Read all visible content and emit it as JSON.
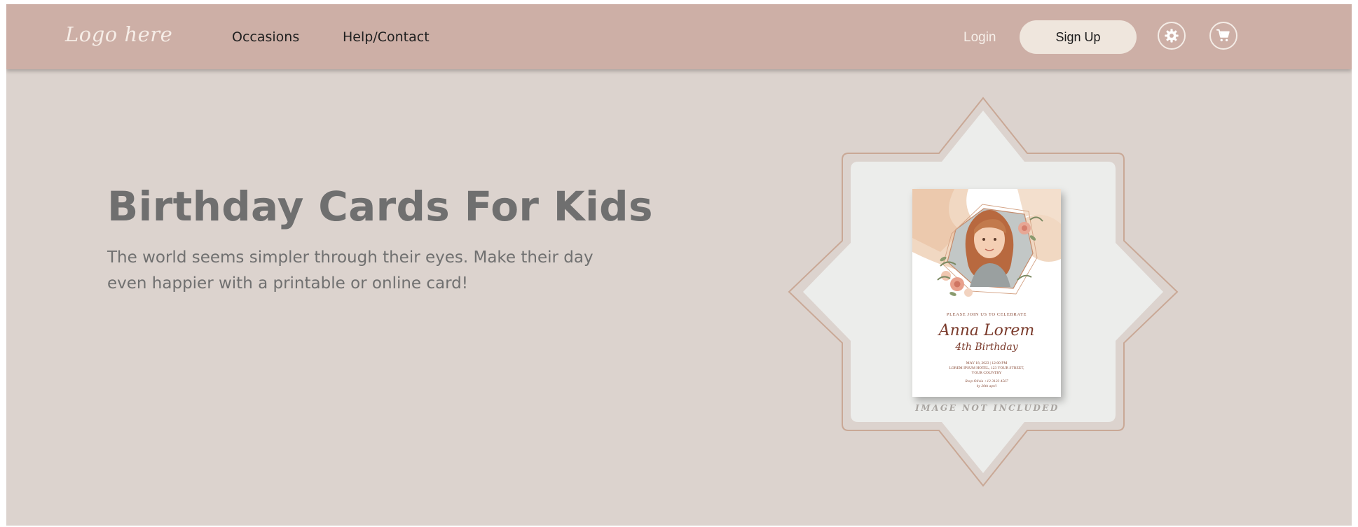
{
  "navbar": {
    "logo": "Logo here",
    "links": [
      "Occasions",
      "Help/Contact"
    ],
    "login": "Login",
    "signup": "Sign Up",
    "icons": [
      "gear-icon",
      "cart-icon"
    ]
  },
  "hero": {
    "title": "Birthday Cards For Kids",
    "subtitle": "The world seems simpler through their eyes. Make their day even happier with a printable or online card!"
  },
  "card": {
    "tagline": "PLEASE JOIN US TO CELEBRATE",
    "name": "Anna Lorem",
    "occasion": "4th Birthday",
    "details_line1": "MAY 18, 2023 | 12:00 PM",
    "details_line2": "LOREM IPSUM HOTEL, 123 YOUR STREET,",
    "details_line3": "YOUR COUNTRY",
    "rsvp_line1": "Rsvp Olivia +12 3123 4567",
    "rsvp_line2": "by 20th april",
    "note": "IMAGE NOT INCLUDED"
  },
  "colors": {
    "navbar": "#cdafa6",
    "background": "#dcd3ce",
    "signup_bg": "#efe6dd",
    "star_fill": "#ecedeb",
    "star_outline": "#c9a896",
    "title_text": "#6f6f6f"
  }
}
